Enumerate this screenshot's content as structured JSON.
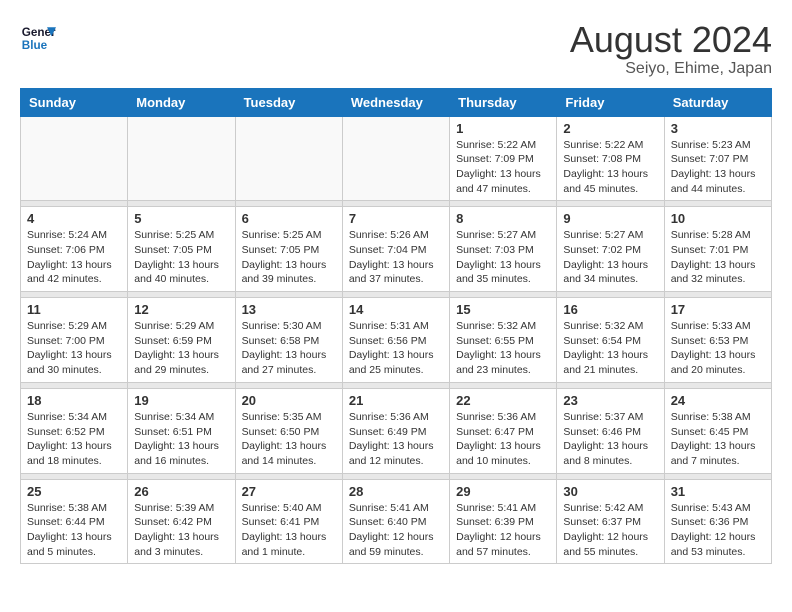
{
  "logo": {
    "line1": "General",
    "line2": "Blue"
  },
  "title": "August 2024",
  "location": "Seiyo, Ehime, Japan",
  "days_of_week": [
    "Sunday",
    "Monday",
    "Tuesday",
    "Wednesday",
    "Thursday",
    "Friday",
    "Saturday"
  ],
  "weeks": [
    [
      {
        "day": "",
        "info": ""
      },
      {
        "day": "",
        "info": ""
      },
      {
        "day": "",
        "info": ""
      },
      {
        "day": "",
        "info": ""
      },
      {
        "day": "1",
        "info": "Sunrise: 5:22 AM\nSunset: 7:09 PM\nDaylight: 13 hours\nand 47 minutes."
      },
      {
        "day": "2",
        "info": "Sunrise: 5:22 AM\nSunset: 7:08 PM\nDaylight: 13 hours\nand 45 minutes."
      },
      {
        "day": "3",
        "info": "Sunrise: 5:23 AM\nSunset: 7:07 PM\nDaylight: 13 hours\nand 44 minutes."
      }
    ],
    [
      {
        "day": "4",
        "info": "Sunrise: 5:24 AM\nSunset: 7:06 PM\nDaylight: 13 hours\nand 42 minutes."
      },
      {
        "day": "5",
        "info": "Sunrise: 5:25 AM\nSunset: 7:05 PM\nDaylight: 13 hours\nand 40 minutes."
      },
      {
        "day": "6",
        "info": "Sunrise: 5:25 AM\nSunset: 7:05 PM\nDaylight: 13 hours\nand 39 minutes."
      },
      {
        "day": "7",
        "info": "Sunrise: 5:26 AM\nSunset: 7:04 PM\nDaylight: 13 hours\nand 37 minutes."
      },
      {
        "day": "8",
        "info": "Sunrise: 5:27 AM\nSunset: 7:03 PM\nDaylight: 13 hours\nand 35 minutes."
      },
      {
        "day": "9",
        "info": "Sunrise: 5:27 AM\nSunset: 7:02 PM\nDaylight: 13 hours\nand 34 minutes."
      },
      {
        "day": "10",
        "info": "Sunrise: 5:28 AM\nSunset: 7:01 PM\nDaylight: 13 hours\nand 32 minutes."
      }
    ],
    [
      {
        "day": "11",
        "info": "Sunrise: 5:29 AM\nSunset: 7:00 PM\nDaylight: 13 hours\nand 30 minutes."
      },
      {
        "day": "12",
        "info": "Sunrise: 5:29 AM\nSunset: 6:59 PM\nDaylight: 13 hours\nand 29 minutes."
      },
      {
        "day": "13",
        "info": "Sunrise: 5:30 AM\nSunset: 6:58 PM\nDaylight: 13 hours\nand 27 minutes."
      },
      {
        "day": "14",
        "info": "Sunrise: 5:31 AM\nSunset: 6:56 PM\nDaylight: 13 hours\nand 25 minutes."
      },
      {
        "day": "15",
        "info": "Sunrise: 5:32 AM\nSunset: 6:55 PM\nDaylight: 13 hours\nand 23 minutes."
      },
      {
        "day": "16",
        "info": "Sunrise: 5:32 AM\nSunset: 6:54 PM\nDaylight: 13 hours\nand 21 minutes."
      },
      {
        "day": "17",
        "info": "Sunrise: 5:33 AM\nSunset: 6:53 PM\nDaylight: 13 hours\nand 20 minutes."
      }
    ],
    [
      {
        "day": "18",
        "info": "Sunrise: 5:34 AM\nSunset: 6:52 PM\nDaylight: 13 hours\nand 18 minutes."
      },
      {
        "day": "19",
        "info": "Sunrise: 5:34 AM\nSunset: 6:51 PM\nDaylight: 13 hours\nand 16 minutes."
      },
      {
        "day": "20",
        "info": "Sunrise: 5:35 AM\nSunset: 6:50 PM\nDaylight: 13 hours\nand 14 minutes."
      },
      {
        "day": "21",
        "info": "Sunrise: 5:36 AM\nSunset: 6:49 PM\nDaylight: 13 hours\nand 12 minutes."
      },
      {
        "day": "22",
        "info": "Sunrise: 5:36 AM\nSunset: 6:47 PM\nDaylight: 13 hours\nand 10 minutes."
      },
      {
        "day": "23",
        "info": "Sunrise: 5:37 AM\nSunset: 6:46 PM\nDaylight: 13 hours\nand 8 minutes."
      },
      {
        "day": "24",
        "info": "Sunrise: 5:38 AM\nSunset: 6:45 PM\nDaylight: 13 hours\nand 7 minutes."
      }
    ],
    [
      {
        "day": "25",
        "info": "Sunrise: 5:38 AM\nSunset: 6:44 PM\nDaylight: 13 hours\nand 5 minutes."
      },
      {
        "day": "26",
        "info": "Sunrise: 5:39 AM\nSunset: 6:42 PM\nDaylight: 13 hours\nand 3 minutes."
      },
      {
        "day": "27",
        "info": "Sunrise: 5:40 AM\nSunset: 6:41 PM\nDaylight: 13 hours\nand 1 minute."
      },
      {
        "day": "28",
        "info": "Sunrise: 5:41 AM\nSunset: 6:40 PM\nDaylight: 12 hours\nand 59 minutes."
      },
      {
        "day": "29",
        "info": "Sunrise: 5:41 AM\nSunset: 6:39 PM\nDaylight: 12 hours\nand 57 minutes."
      },
      {
        "day": "30",
        "info": "Sunrise: 5:42 AM\nSunset: 6:37 PM\nDaylight: 12 hours\nand 55 minutes."
      },
      {
        "day": "31",
        "info": "Sunrise: 5:43 AM\nSunset: 6:36 PM\nDaylight: 12 hours\nand 53 minutes."
      }
    ]
  ]
}
